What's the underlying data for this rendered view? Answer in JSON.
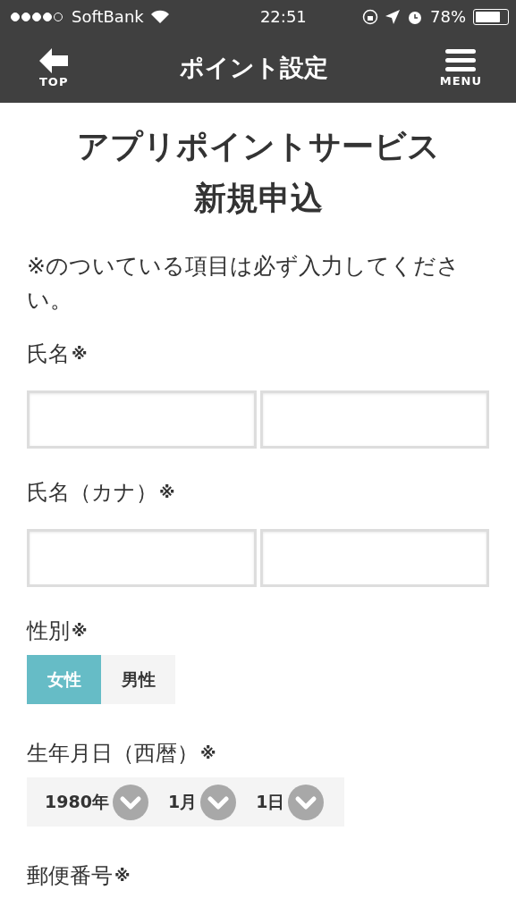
{
  "status_bar": {
    "signal_dots": [
      {
        "filled": true
      },
      {
        "filled": true
      },
      {
        "filled": true
      },
      {
        "filled": true
      },
      {
        "filled": false
      }
    ],
    "carrier": "SoftBank",
    "time": "22:51",
    "battery": "78%"
  },
  "nav": {
    "back": "TOP",
    "title": "ポイント設定",
    "menu": "MENU"
  },
  "heading": [
    "アプリポイントサービス",
    "新規申込"
  ],
  "note": "※のついている項目は必ず入力してください。",
  "fields": [
    {
      "kind": "name-pair",
      "label": "氏名",
      "mark": "※"
    },
    {
      "kind": "name-pair",
      "label": "氏名（カナ）",
      "mark": "※"
    },
    {
      "kind": "choice",
      "label": "性別",
      "mark": "※",
      "options": [
        {
          "label": "女性",
          "selected": true
        },
        {
          "label": "男性",
          "selected": false
        }
      ]
    },
    {
      "kind": "date",
      "label": "生年月日（西暦）",
      "mark": "※",
      "selects": [
        "1980年",
        "1月",
        "1日"
      ]
    },
    {
      "kind": "text",
      "label": "郵便番号",
      "mark": "※"
    }
  ]
}
